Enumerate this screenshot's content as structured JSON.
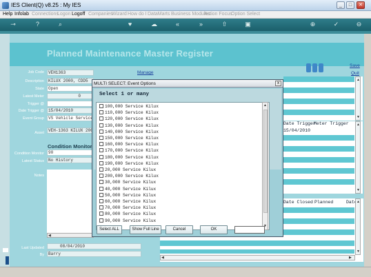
{
  "window": {
    "title": "IES Client(Q) v8.25 : My IES",
    "buttons": [
      "_",
      "□",
      "✕"
    ]
  },
  "menu": {
    "items": [
      {
        "label": "Help",
        "disabled": false
      },
      {
        "label": "Infolab",
        "disabled": false
      },
      {
        "label": "Connections",
        "disabled": true
      },
      {
        "label": "Logon",
        "disabled": true
      },
      {
        "label": "Logoff",
        "disabled": false
      },
      {
        "label": "Companies",
        "disabled": true
      },
      {
        "label": "Wizard",
        "disabled": true
      },
      {
        "label": "How do I",
        "disabled": true
      },
      {
        "label": "DataMarts",
        "disabled": true
      },
      {
        "label": "Business Modules",
        "disabled": true
      },
      {
        "label": "Action Focus",
        "disabled": true
      },
      {
        "label": "Option Select",
        "disabled": true
      }
    ]
  },
  "toolbar": {
    "icons": [
      "key-icon",
      "help-icon",
      "search-icon",
      "heart-icon",
      "cloud-icon",
      "rewind-icon",
      "fast-forward-icon",
      "upload-icon",
      "print-icon",
      "add-icon",
      "check-icon",
      "minus-icon"
    ]
  },
  "page": {
    "title": "Planned Maintenance Master Register",
    "manage_link": "Manage",
    "save_link": "Save",
    "quit_link": "Quit"
  },
  "form": {
    "job_code_label": "Job Code",
    "job_code": "VEH1363",
    "description_label": "Description",
    "description": "KILUX 2000, CDD5",
    "state_label": "State",
    "state": "Open",
    "latest_meter_label": "Latest Meter",
    "latest_meter": "0",
    "trigger_label": "Trigger @",
    "date_trigger_label": "Date Trigger @",
    "date_trigger": "15/04/2010",
    "event_group_label": "Event Group",
    "event_group": "VS Vehicle Service",
    "asset_label": "Asset",
    "asset": "VEH-1363 KILUX 200",
    "condition_monitor_heading": "Condition Monitor:",
    "condition_monitor_label": "Condition Monitor",
    "condition_monitor": "90",
    "latest_status_label": "Latest Status",
    "latest_status": "No History",
    "notes_label": "Notes",
    "last_updated_label": "Last Updated",
    "last_updated": "08/04/2010",
    "by_label": "By",
    "by": "Barry"
  },
  "right_table": {
    "col1": "Date Trigger",
    "col2": "Meter Trigger",
    "row1": "15/04/2010"
  },
  "lower_table": {
    "col1": "Date Closed",
    "col2": "Planned",
    "col3": "Date"
  },
  "dialog": {
    "title": "MULTI SELECT: Event Options",
    "close": "x",
    "heading": "Select 1 or many",
    "items": [
      "100,000 Service Kilux",
      "110,000 Service Kilux",
      "120,000 Service Kilux",
      "130,000 Service Kilux",
      "140,000 Service Kilux",
      "150,000 Service Kilux",
      "160,000 Service Kilux",
      "170,000 Service Kilux",
      "180,000 Service Kilux",
      "190,000 Service Kilux",
      "20,000 Service Kilux",
      "200,000 Service Kilux",
      "30,000 Service Kilux",
      "40,000 Service Kilux",
      "50,000 Service Kilux",
      "60,000 Service Kilux",
      "70,000 Service Kilux",
      "80,000 Service Kilux",
      "90,000 Service Kilux"
    ],
    "buttons": {
      "select_all": "Select ALL",
      "show_full_line": "Show Full Line",
      "cancel": "Cancel",
      "ok": "OK"
    }
  }
}
